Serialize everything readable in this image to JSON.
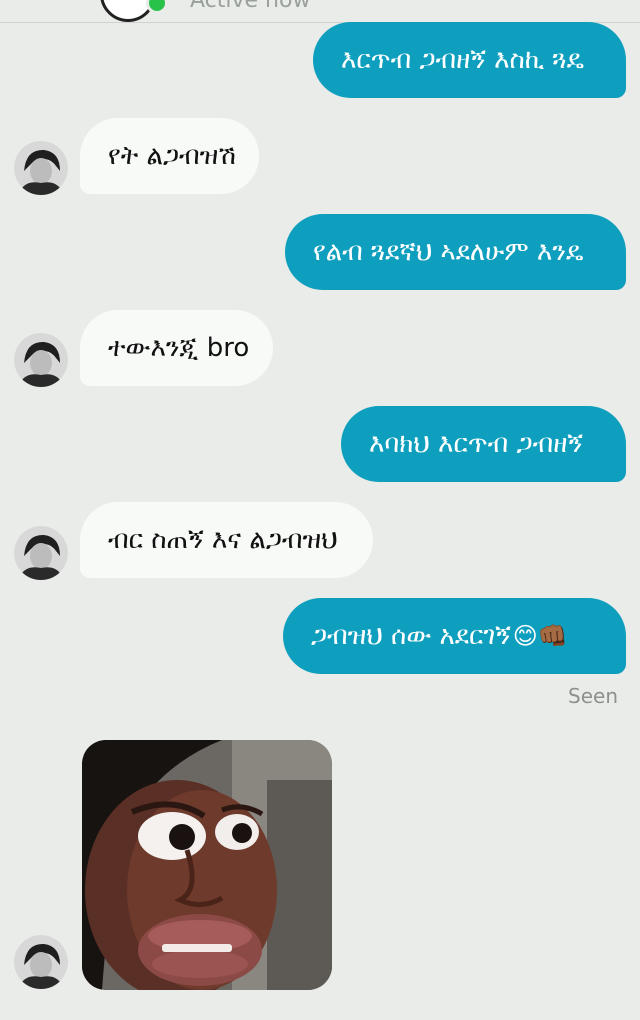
{
  "header": {
    "status": "Active now"
  },
  "messages": [
    {
      "text": "እርጥብ ጋብዘኝ እስኪ ጓዴ"
    },
    {
      "text": "የት ልጋብዝሽ"
    },
    {
      "text": "የልብ ጓደኛህ ኣደለሁም እንዴ"
    },
    {
      "text": "ተውእንጂ bro"
    },
    {
      "text": "እባክህ እርጥብ ጋብዘኝ"
    },
    {
      "text": "ብር ስጠኝ እና ልጋብዝህ"
    },
    {
      "text": "ጋብዝህ ሰው አደርገኝ",
      "emoji": "😊👊🏾"
    }
  ],
  "seen_label": "Seen",
  "colors": {
    "outgoing_bubble": "#0f9fbe",
    "incoming_bubble": "#f8faf8",
    "background": "#e9ece9",
    "online": "#28c24a"
  },
  "icons": {
    "avatar": "contact-avatar-photo",
    "sticker": "surprised-face-photo"
  }
}
